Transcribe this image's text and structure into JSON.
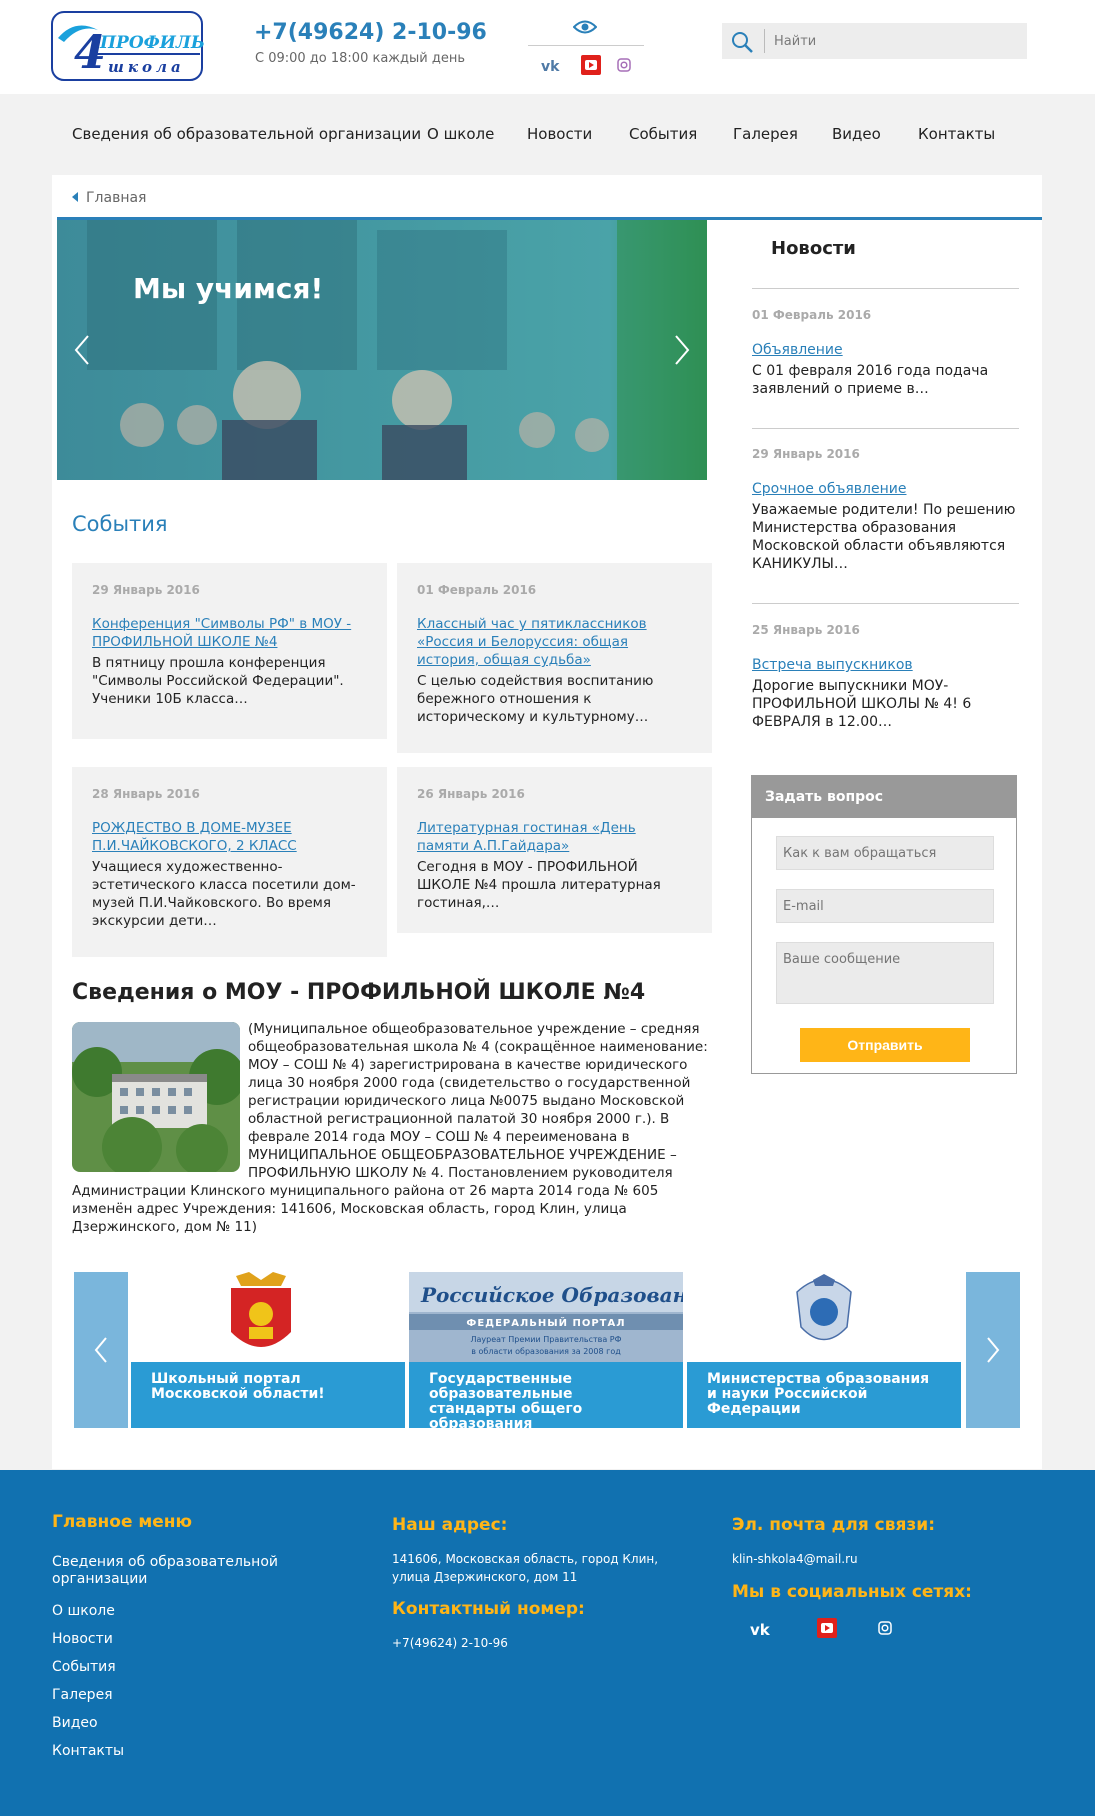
{
  "brand": {
    "logo_text_top": "ПРОФИЛЬ",
    "logo_text_bottom": "школа",
    "logo_number": "4"
  },
  "header": {
    "phone": "+7(49624) 2-10-96",
    "hours": "С 09:00 до 18:00 каждый день",
    "search_placeholder": "Найти",
    "accent_color": "#2a80b9"
  },
  "nav": {
    "items": [
      {
        "label": "Сведения об образовательной организации"
      },
      {
        "label": "О школе"
      },
      {
        "label": "Новости"
      },
      {
        "label": "События"
      },
      {
        "label": "Галерея"
      },
      {
        "label": "Видео"
      },
      {
        "label": "Контакты"
      }
    ]
  },
  "breadcrumb": {
    "home": "Главная"
  },
  "slider": {
    "title": "Мы учимся!"
  },
  "events": {
    "title": "События",
    "items": [
      {
        "date": "29 Январь 2016",
        "link": "Конференция \"Символы РФ\" в МОУ - ПРОФИЛЬНОЙ ШКОЛЕ №4",
        "text": "В пятницу прошла конференция \"Символы Российской Федерации\". Ученики 10Б класса…"
      },
      {
        "date": "01 Февраль 2016",
        "link": "Классный час у пятиклассников «Россия и Белоруссия: общая история, общая судьба»",
        "text": "С целью содействия воспитанию бережного отношения к историческому и культурному…"
      },
      {
        "date": "28 Январь 2016",
        "link": "РОЖДЕСТВО В ДОМЕ-МУЗЕЕ П.И.ЧАЙКОВСКОГО, 2 КЛАСС",
        "text": "Учащиеся художественно-эстетического класса посетили дом-музей П.И.Чайковского. Во время экскурсии дети…"
      },
      {
        "date": "26 Январь 2016",
        "link": "Литературная гостиная «День памяти А.П.Гайдара»",
        "text": "Сегодня в МОУ - ПРОФИЛЬНОЙ ШКОЛЕ №4 прошла литературная гостиная,…"
      }
    ]
  },
  "about": {
    "title": "Сведения о МОУ - ПРОФИЛЬНОЙ ШКОЛЕ №4",
    "text": "(Муниципальное общеобразовательное учреждение – средняя общеобразовательная школа № 4 (сокращённое наименование: МОУ – СОШ № 4) зарегистрирована в качестве юридического лица 30 ноября 2000 года (свидетельство о государственной регистрации юридического лица №0075 выдано Московской областной регистрационной палатой 30 ноября 2000 г.). В феврале 2014 года МОУ – СОШ № 4 переименована в МУНИЦИПАЛЬНОЕ ОБЩЕОБРАЗОВАТЕЛЬНОЕ УЧРЕЖДЕНИЕ – ПРОФИЛЬНУЮ ШКОЛУ № 4. Постановлением руководителя Администрации Клинского муниципального района от 26 марта 2014 года № 605 изменён адрес Учреждения: 141606, Московская область, город Клин, улица Дзержинского, дом № 11)"
  },
  "news": {
    "title": "Новости",
    "items": [
      {
        "date": "01 Февраль 2016",
        "link": "Объявление",
        "text": "С  01 февраля 2016 года подача заявлений о приеме в…"
      },
      {
        "date": "29 Январь 2016",
        "link": "Срочное объявление",
        "text": "Уважаемые родители! По решению Министерства образования Московской области объявляются КАНИКУЛЫ…"
      },
      {
        "date": "25 Январь 2016",
        "link": "Встреча выпускников",
        "text": "Дорогие выпускники МОУ-ПРОФИЛЬНОЙ ШКОЛЫ № 4!  6 ФЕВРАЛЯ в 12.00…"
      }
    ]
  },
  "ask": {
    "title": "Задать вопрос",
    "name_placeholder": "Как к вам обращаться",
    "email_placeholder": "E-mail",
    "message_placeholder": "Ваше сообщение",
    "submit": "Отправить"
  },
  "partners": {
    "items": [
      {
        "caption": "Школьный портал Московской области!"
      },
      {
        "caption": "Государственные образовательные стандарты общего образования",
        "banner_title": "Российское Образование",
        "banner_sub": "ФЕДЕРАЛЬНЫЙ ПОРТАЛ",
        "banner_note1": "Лауреат Премии Правительства РФ",
        "banner_note2": "в области образования за 2008 год"
      },
      {
        "caption": "Министерства образования и науки Российской Федерации"
      }
    ]
  },
  "footer": {
    "menu_title": "Главное меню",
    "menu": [
      "Сведения об образовательной организации",
      "О школе",
      "Новости",
      "События",
      "Галерея",
      "Видео",
      "Контакты"
    ],
    "address_title": "Наш адрес:",
    "address": "141606, Московская область, город Клин, улица Дзержинского, дом 11",
    "phone_title": "Контактный номер:",
    "phone": "+7(49624) 2-10-96",
    "email_title": "Эл. почта для связи:",
    "email": "klin-shkola4@mail.ru",
    "social_title": "Мы в социальных сетях:",
    "bg_color": "#1171b0",
    "title_color": "#ffb517"
  }
}
